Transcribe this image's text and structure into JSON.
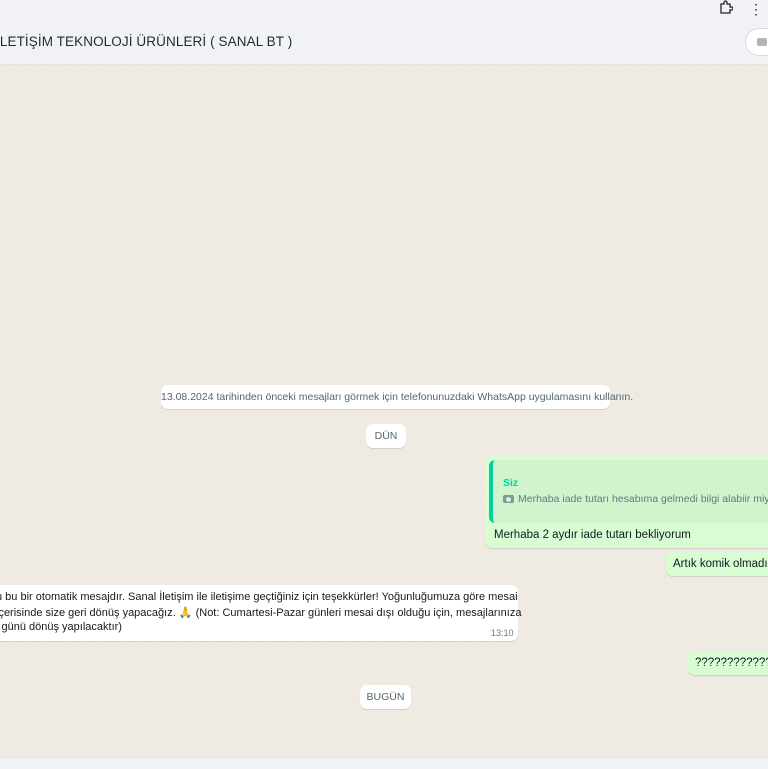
{
  "browser": {
    "extensions_icon": "puzzle-icon",
    "menu_icon": "kebab-menu-icon"
  },
  "header": {
    "title": "İLETİŞİM TEKNOLOJİ ÜRÜNLERİ ( SANAL BT )"
  },
  "system_notice": "13.08.2024 tarihinden önceki mesajları görmek için telefonunuzdaki WhatsApp uygulamasını kullanın.",
  "date_dividers": {
    "yesterday": "DÜN",
    "today": "BUGÜN"
  },
  "quoted_message": {
    "author": "Siz",
    "text": "Merhaba iade tutarı hesabıma gelmedi bilgi alabiir miyim"
  },
  "messages_out": {
    "reply_text": "Merhaba 2 aydır iade tutarı  bekliyorum",
    "second_text": "Artık komik olmadı m",
    "question_text": "??????????????"
  },
  "message_in": {
    "line1": "u bu bir otomatik mesajdır. Sanal İletişim ile iletişime geçtiğiniz için teşekkürler! Yoğunluğumuza göre mesai",
    "line2": "içerisinde size geri dönüş yapacağız.",
    "emoji": "🙏",
    "line2_rest": " (Not: Cumartesi-Pazar günleri mesai dışı olduğu için, mesajlarınıza",
    "line3": "i günü dönüş yapılacaktır)",
    "time": "13:10"
  },
  "colors": {
    "outgoing_bubble": "#d9fdd3",
    "incoming_bubble": "#ffffff",
    "chat_background": "#efeae2",
    "quote_accent": "#06cf9c"
  }
}
